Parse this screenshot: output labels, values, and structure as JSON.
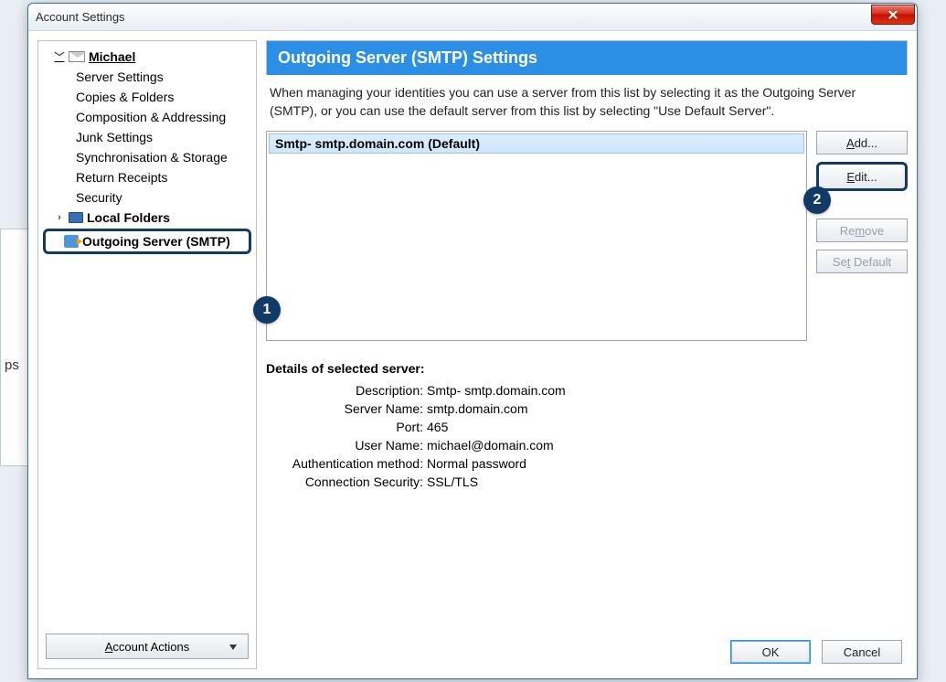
{
  "window": {
    "title": "Account Settings"
  },
  "sidebar": {
    "account_name": "Michael",
    "items": [
      "Server Settings",
      "Copies & Folders",
      "Composition & Addressing",
      "Junk Settings",
      "Synchronisation & Storage",
      "Return Receipts",
      "Security"
    ],
    "local_folders": "Local Folders",
    "outgoing": "Outgoing Server (SMTP)",
    "account_actions_prefix": "A",
    "account_actions_rest": "ccount Actions"
  },
  "panel": {
    "title": "Outgoing Server (SMTP) Settings",
    "description": "When managing your identities you can use a server from this list by selecting it as the Outgoing Server (SMTP), or you can use the default server from this list by selecting \"Use Default Server\"."
  },
  "servers": {
    "selected": "Smtp- smtp.domain.com (Default)"
  },
  "buttons": {
    "add_prefix": "A",
    "add_rest": "dd...",
    "edit_prefix": "E",
    "edit_rest": "dit...",
    "remove_pre": "Re",
    "remove_u": "m",
    "remove_post": "ove",
    "setdef_pre": "Se",
    "setdef_u": "t",
    "setdef_post": " Default",
    "ok": "OK",
    "cancel": "Cancel"
  },
  "details": {
    "heading": "Details of selected server:",
    "rows": {
      "description_label": "Description:",
      "description_value": "Smtp- smtp.domain.com",
      "server_label": "Server Name:",
      "server_value": "smtp.domain.com",
      "port_label": "Port:",
      "port_value": "465",
      "user_label": "User Name:",
      "user_value": "michael@domain.com",
      "auth_label": "Authentication method:",
      "auth_value": "Normal password",
      "sec_label": "Connection Security:",
      "sec_value": "SSL/TLS"
    }
  },
  "callouts": {
    "one": "1",
    "two": "2"
  }
}
